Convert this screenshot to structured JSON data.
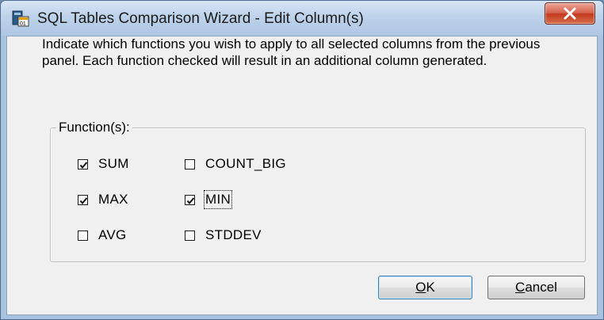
{
  "window": {
    "title": "SQL Tables Comparison Wizard - Edit Column(s)",
    "icon": "db-table-icon"
  },
  "titlebar": {
    "close_icon": "close-icon"
  },
  "instructions": {
    "line1": "Indicate which functions you wish to apply to all selected columns from the previous",
    "line2": "panel.  Each function checked will result in an additional column generated."
  },
  "functions_group": {
    "legend": "Function(s):",
    "options": [
      {
        "label": "SUM",
        "checked": true
      },
      {
        "label": "COUNT_BIG",
        "checked": false
      },
      {
        "label": "MAX",
        "checked": true
      },
      {
        "label": "MIN",
        "checked": true,
        "focused": true
      },
      {
        "label": "AVG",
        "checked": false
      },
      {
        "label": "STDDEV",
        "checked": false
      }
    ]
  },
  "buttons": {
    "ok_mnemonic": "O",
    "ok_rest": "K",
    "cancel_mnemonic": "C",
    "cancel_rest": "ancel"
  },
  "colors": {
    "titlebar": "#bdd2ea",
    "client_bg": "#f0f0f0",
    "close_red": "#c4381d"
  }
}
